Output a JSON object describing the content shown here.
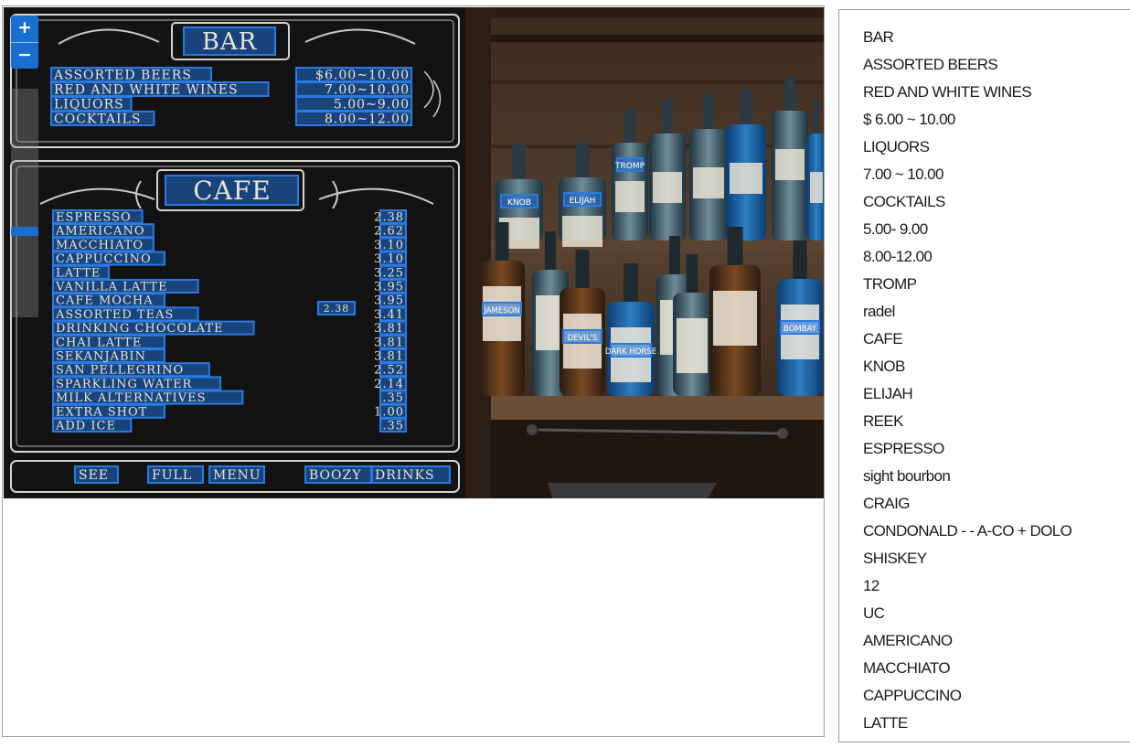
{
  "viewer": {
    "zoom_in_label": "+",
    "zoom_out_label": "−",
    "zoom_level_fraction": 0.33
  },
  "menu_board": {
    "bar_title": "BAR",
    "bar_items": [
      "ASSORTED BEERS",
      "RED AND WHITE WINES",
      "LIQUORS",
      "COCKTAILS"
    ],
    "bar_prices": [
      "$6.00~10.00",
      "7.00~10.00",
      "5.00~9.00",
      "8.00~12.00"
    ],
    "cafe_title": "CAFE",
    "cafe_items": [
      "ESPRESSO",
      "AMERICANO",
      "MACCHIATO",
      "CAPPUCCINO",
      "LATTE",
      "VANILLA LATTE",
      "CAFE MOCHA",
      "ASSORTED TEAS",
      "DRINKING CHOCOLATE",
      "CHAI LATTE",
      "SEKANJABIN",
      "SAN PELLEGRINO",
      "SPARKLING WATER",
      "MILK ALTERNATIVES",
      "EXTRA SHOT",
      "ADD ICE"
    ],
    "cafe_prices": [
      "2.38",
      "2.62",
      "3.10",
      "3.10",
      "3.25",
      "3.95",
      "3.95",
      "3.41",
      "3.81",
      "3.81",
      "3.81",
      "2.52",
      "2.14",
      ".35",
      "1.00",
      ".35"
    ],
    "teas_tag": "2.38",
    "footer_words": [
      "SEE",
      "FULL",
      "MENU",
      "BOOZY",
      "DRINKS"
    ]
  },
  "bottles": {
    "labels": [
      "KNOB",
      "ELIJAH",
      "TROMP",
      "JAMESON",
      "DEVIL'S",
      "DARK HORSE",
      "BOMBAY"
    ]
  },
  "recognized_text": [
    "BAR",
    "ASSORTED BEERS",
    "RED AND WHITE WINES",
    "$ 6.00 ~ 10.00",
    "LIQUORS",
    "7.00 ~ 10.00",
    "COCKTAILS",
    "5.00- 9.00",
    "8.00-12.00",
    "TROMP",
    "radel",
    "CAFE",
    "KNOB",
    "ELIJAH",
    "REEK",
    "ESPRESSO",
    "sight bourbon",
    "CRAIG",
    "CONDONALD - - A-CO + DOLO",
    "SHISKEY",
    "12",
    "UC",
    "AMERICANO",
    "MACCHIATO",
    "CAPPUCCINO",
    "LATTE"
  ],
  "colors": {
    "highlight": "#2a7ae2",
    "chalkboard": "#121212",
    "wood": "#4a3526"
  }
}
